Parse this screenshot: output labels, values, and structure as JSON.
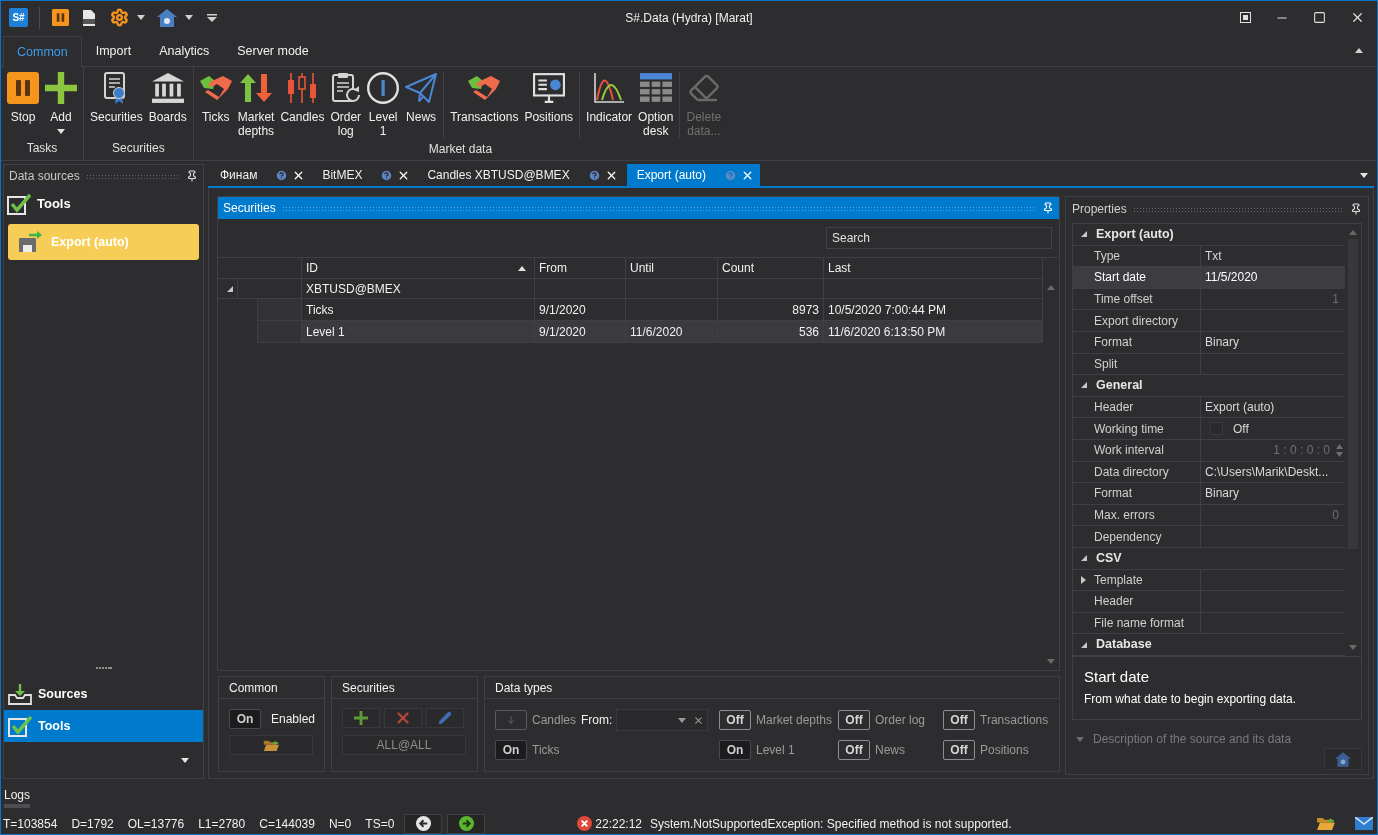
{
  "window": {
    "logo": "S#",
    "title": "S#.Data (Hydra) [Marat]"
  },
  "ribbon": {
    "tabs": [
      {
        "label": "Common",
        "selected": true
      },
      {
        "label": "Import",
        "selected": false
      },
      {
        "label": "Analytics",
        "selected": false
      },
      {
        "label": "Server mode",
        "selected": false
      }
    ],
    "groups": [
      {
        "label": "Tasks",
        "clusters": [
          {
            "buttons": [
              {
                "label": "Stop",
                "dropdown": false,
                "disabled": false
              },
              {
                "label": "Add",
                "dropdown": true,
                "disabled": false
              }
            ]
          }
        ]
      },
      {
        "label": "Securities",
        "clusters": [
          {
            "buttons": [
              {
                "label": "Securities",
                "dropdown": false,
                "disabled": false
              },
              {
                "label": "Boards",
                "dropdown": false,
                "disabled": false
              }
            ]
          }
        ]
      },
      {
        "label": "Market data",
        "clusters": [
          {
            "buttons": [
              {
                "label": "Ticks",
                "dropdown": false,
                "disabled": false
              },
              {
                "label": "Market depths",
                "dropdown": false,
                "disabled": false
              },
              {
                "label": "Candles",
                "dropdown": false,
                "disabled": false
              },
              {
                "label": "Order log",
                "dropdown": false,
                "disabled": false
              },
              {
                "label": "Level 1",
                "dropdown": false,
                "disabled": false
              },
              {
                "label": "News",
                "dropdown": false,
                "disabled": false
              }
            ]
          },
          {
            "buttons": [
              {
                "label": "Transactions",
                "dropdown": false,
                "disabled": false
              },
              {
                "label": "Positions",
                "dropdown": false,
                "disabled": false
              }
            ]
          },
          {
            "buttons": [
              {
                "label": "Indicator",
                "dropdown": false,
                "disabled": false
              },
              {
                "label": "Option desk",
                "dropdown": false,
                "disabled": false
              }
            ]
          },
          {
            "buttons": [
              {
                "label": "Delete data...",
                "dropdown": false,
                "disabled": true
              }
            ]
          }
        ]
      }
    ]
  },
  "data_sources": {
    "title": "Data sources",
    "section": "Tools",
    "items": [
      {
        "label": "Export (auto)",
        "selected": true
      }
    ],
    "nav": [
      {
        "label": "Sources",
        "selected": false
      },
      {
        "label": "Tools",
        "selected": true
      }
    ]
  },
  "documents": {
    "tabs": [
      {
        "label": "Финам",
        "selected": false
      },
      {
        "label": "BitMEX",
        "selected": false
      },
      {
        "label": "Candles XBTUSD@BMEX",
        "selected": false
      },
      {
        "label": "Export (auto)",
        "selected": true
      }
    ]
  },
  "securities": {
    "title": "Securities",
    "search": {
      "placeholder": "Search"
    },
    "table": {
      "columns": [
        {
          "label": "ID",
          "sorted": true
        },
        {
          "label": "From",
          "sorted": false
        },
        {
          "label": "Until",
          "sorted": false
        },
        {
          "label": "Count",
          "sorted": false
        },
        {
          "label": "Last",
          "sorted": false
        }
      ],
      "groups": [
        {
          "label": "XBTUSD@BMEX",
          "expanded": true,
          "rows": [
            {
              "id": "Ticks",
              "from": "9/1/2020",
              "count": "8973",
              "last": "10/5/2020 7:00:44 PM",
              "selected": false
            },
            {
              "id": "Level 1",
              "from": "9/1/2020",
              "until": "11/6/2020",
              "count": "536",
              "last": "11/6/2020 6:13:50 PM",
              "selected": true
            }
          ]
        }
      ]
    }
  },
  "common_box": {
    "title": "Common",
    "switch": "On",
    "on": true,
    "label": "Enabled"
  },
  "securities_box": {
    "title": "Securities",
    "filter": "ALL@ALL"
  },
  "data_types": {
    "title": "Data types",
    "items": [
      {
        "kind": "picker",
        "label": "Candles",
        "from_label": "From:"
      },
      {
        "kind": "toggle",
        "label": "Market depths",
        "switch": "Off",
        "on": false
      },
      {
        "kind": "toggle",
        "label": "Order log",
        "switch": "Off",
        "on": false
      },
      {
        "kind": "toggle",
        "label": "Transactions",
        "switch": "Off",
        "on": false
      },
      {
        "kind": "toggle",
        "label": "Ticks",
        "switch": "On",
        "on": true
      },
      {
        "kind": "toggle",
        "label": "Level 1",
        "switch": "On",
        "on": true
      },
      {
        "kind": "toggle",
        "label": "News",
        "switch": "Off",
        "on": false
      },
      {
        "kind": "toggle",
        "label": "Positions",
        "switch": "Off",
        "on": false
      }
    ]
  },
  "properties": {
    "title": "Properties",
    "categories": [
      {
        "label": "Export (auto)",
        "expanded": true,
        "items": [
          {
            "name": "Type",
            "kind": "text",
            "value": "Txt",
            "selected": false
          },
          {
            "name": "Start date",
            "kind": "text",
            "value": "11/5/2020",
            "selected": true
          },
          {
            "name": "Time offset",
            "kind": "number",
            "value": "1",
            "selected": false
          },
          {
            "name": "Export directory",
            "kind": "text",
            "selected": false
          },
          {
            "name": "Format",
            "kind": "text",
            "value": "Binary",
            "selected": false
          },
          {
            "name": "Split",
            "kind": "text",
            "selected": false
          }
        ]
      },
      {
        "label": "General",
        "expanded": true,
        "items": [
          {
            "name": "Header",
            "kind": "text",
            "value": "Export (auto)",
            "selected": false
          },
          {
            "name": "Working time",
            "kind": "toggle",
            "value": "Off",
            "checked": false,
            "selected": false
          },
          {
            "name": "Work interval",
            "kind": "interval",
            "value": "1 : 0 : 0 : 0",
            "selected": false
          },
          {
            "name": "Data directory",
            "kind": "text",
            "value": "C:\\Users\\Marik\\Deskt...",
            "selected": false
          },
          {
            "name": "Format",
            "kind": "text",
            "value": "Binary",
            "selected": false
          },
          {
            "name": "Max. errors",
            "kind": "number",
            "value": "0",
            "selected": false
          },
          {
            "name": "Dependency",
            "kind": "text",
            "selected": false
          }
        ]
      },
      {
        "label": "CSV",
        "expanded": true,
        "items": [
          {
            "name": "Template",
            "kind": "group",
            "expanded": false,
            "selected": false
          },
          {
            "name": "Header",
            "kind": "text",
            "selected": false
          },
          {
            "name": "File name format",
            "kind": "text",
            "selected": false
          }
        ]
      },
      {
        "label": "Database",
        "expanded": true
      }
    ],
    "help": {
      "title": "Start date",
      "text": "From what date to begin exporting data."
    },
    "description_toggle": "Description of the source and its data"
  },
  "logs": {
    "title": "Logs"
  },
  "status_bar": {
    "counters": [
      "T=103854",
      "D=1792",
      "OL=13776",
      "L1=2780",
      "C=144039",
      "N=0",
      "TS=0"
    ],
    "error": {
      "time": "22:22:12",
      "message": "System.NotSupportedException: Specified method is not supported."
    }
  }
}
